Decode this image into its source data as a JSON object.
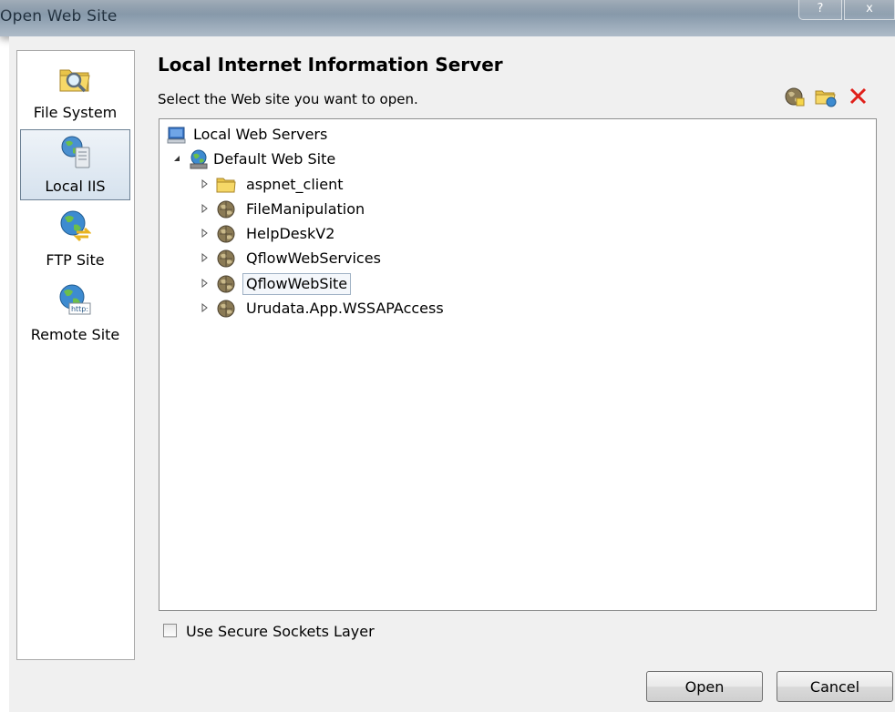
{
  "window": {
    "title": "Open Web Site",
    "help_label": "?",
    "close_label": "x"
  },
  "sidebar": {
    "items": [
      {
        "label": "File System",
        "icon": "folder-search-icon",
        "selected": false
      },
      {
        "label": "Local IIS",
        "icon": "local-iis-icon",
        "selected": true
      },
      {
        "label": "FTP Site",
        "icon": "ftp-globe-icon",
        "selected": false
      },
      {
        "label": "Remote Site",
        "icon": "http-globe-icon",
        "selected": false
      }
    ]
  },
  "main": {
    "heading": "Local Internet Information Server",
    "instruction": "Select the Web site you want to open.",
    "toolbar": [
      {
        "icon": "new-web-application-icon"
      },
      {
        "icon": "new-virtual-directory-icon"
      },
      {
        "icon": "delete-icon"
      }
    ]
  },
  "tree": {
    "root": {
      "label": "Local Web Servers",
      "icon": "computer-icon"
    },
    "site": {
      "label": "Default Web Site",
      "icon": "globe-server-icon",
      "expanded": true
    },
    "children": [
      {
        "label": "aspnet_client",
        "icon": "folder-icon"
      },
      {
        "label": "FileManipulation",
        "icon": "web-app-icon"
      },
      {
        "label": "HelpDeskV2",
        "icon": "web-app-icon"
      },
      {
        "label": "QflowWebServices",
        "icon": "web-app-icon"
      },
      {
        "label": "QflowWebSite",
        "icon": "web-app-icon",
        "selected": true
      },
      {
        "label": "Urudata.App.WSSAPAccess",
        "icon": "web-app-icon"
      }
    ]
  },
  "options": {
    "ssl_label": "Use Secure Sockets Layer",
    "ssl_checked": false
  },
  "buttons": {
    "open": "Open",
    "cancel": "Cancel"
  },
  "colors": {
    "selection_border": "#6d8194",
    "delete_red": "#e0201a",
    "folder_yellow": "#f0c838"
  }
}
